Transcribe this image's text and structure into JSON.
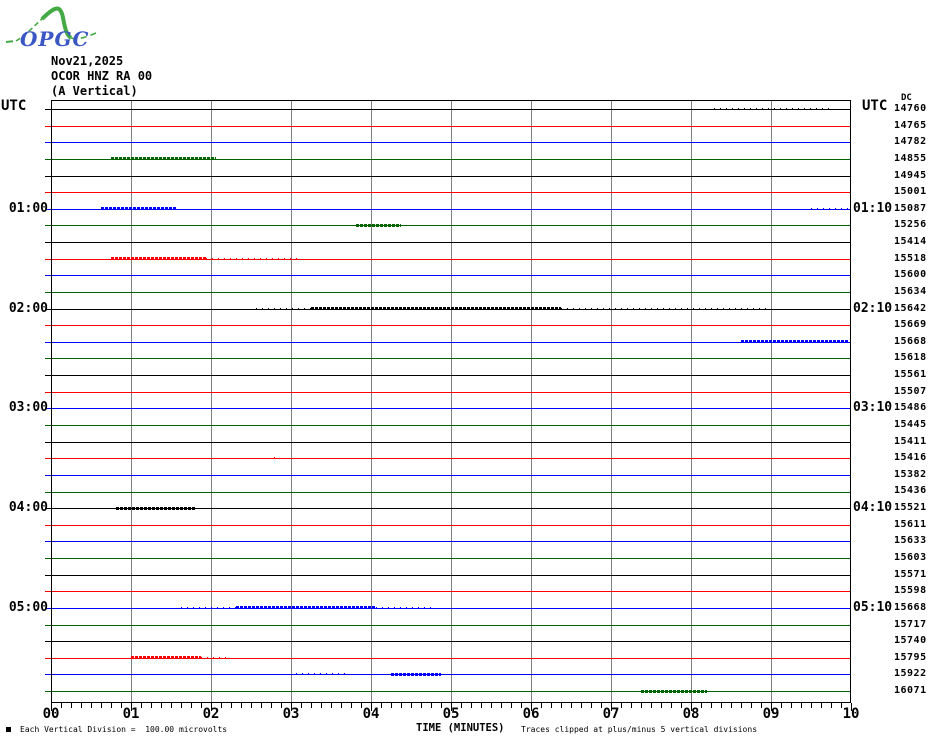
{
  "header": {
    "logo_text": "OPGC",
    "date": "Nov21,2025",
    "station": "OCOR HNZ RA 00",
    "component": "(A Vertical)"
  },
  "axes": {
    "left_utc": "UTC",
    "right_utc": "UTC",
    "dc_label": "DC",
    "x_title": "TIME (MINUTES)",
    "x_tick_labels": [
      "00",
      "01",
      "02",
      "03",
      "04",
      "05",
      "06",
      "07",
      "08",
      "09",
      "10"
    ]
  },
  "footer": {
    "scale_note": "Each Vertical Division =  100.00 microvolts",
    "clip_note": "Traces clipped at plus/minus 5 vertical divisions"
  },
  "colors": {
    "black": "#000000",
    "red": "#ff0000",
    "blue": "#0000ff",
    "green": "#006400",
    "grid": "#808080",
    "logo_green": "#44aa44",
    "logo_blue": "#3a57c4"
  },
  "chart_data": {
    "type": "line",
    "description": "Helicorder-style seismogram: 36 ten-minute traces stacked vertically, trace color cycles black/red/blue/green, DC offset of each trace listed at right, noise bursts shown as fuzzy segments",
    "x_axis": {
      "title": "TIME (MINUTES)",
      "min": 0,
      "max": 10,
      "major_tick_step": 1,
      "minor_ticks_per_division": 8
    },
    "y_axis": {
      "division_microvolts": 100.0,
      "clip_divisions": 5
    },
    "utc_left_labels": [
      "01:00",
      "02:00",
      "03:00",
      "04:00",
      "05:00"
    ],
    "utc_right_labels": [
      "01:10",
      "02:10",
      "03:10",
      "04:10",
      "05:10"
    ],
    "traces": [
      {
        "color": "black",
        "dc": 14760,
        "left_label": "",
        "right_label": "",
        "noise": [
          [
            8.28,
            9.74,
            "sparse"
          ]
        ]
      },
      {
        "color": "red",
        "dc": 14765,
        "left_label": "",
        "right_label": "",
        "noise": []
      },
      {
        "color": "blue",
        "dc": 14782,
        "left_label": "",
        "right_label": "",
        "noise": []
      },
      {
        "color": "green",
        "dc": 14855,
        "left_label": "",
        "right_label": "",
        "noise": [
          [
            0.74,
            2.05,
            "dense"
          ]
        ]
      },
      {
        "color": "black",
        "dc": 14945,
        "left_label": "",
        "right_label": "",
        "noise": []
      },
      {
        "color": "red",
        "dc": 15001,
        "left_label": "",
        "right_label": "",
        "noise": []
      },
      {
        "color": "blue",
        "dc": 15087,
        "left_label": "01:00",
        "right_label": "01:10",
        "noise": [
          [
            0.61,
            1.55,
            "dense"
          ],
          [
            9.49,
            9.99,
            "sparse"
          ]
        ]
      },
      {
        "color": "green",
        "dc": 15256,
        "left_label": "",
        "right_label": "",
        "noise": [
          [
            3.8,
            4.36,
            "dense"
          ]
        ]
      },
      {
        "color": "black",
        "dc": 15414,
        "left_label": "",
        "right_label": "",
        "noise": []
      },
      {
        "color": "red",
        "dc": 15518,
        "left_label": "",
        "right_label": "",
        "noise": [
          [
            0.74,
            1.93,
            "dense"
          ],
          [
            1.93,
            3.11,
            "sparse"
          ]
        ]
      },
      {
        "color": "blue",
        "dc": 15600,
        "left_label": "",
        "right_label": "",
        "noise": []
      },
      {
        "color": "green",
        "dc": 15634,
        "left_label": "",
        "right_label": "",
        "noise": []
      },
      {
        "color": "black",
        "dc": 15642,
        "left_label": "02:00",
        "right_label": "02:10",
        "noise": [
          [
            2.55,
            3.24,
            "sparse"
          ],
          [
            3.24,
            6.36,
            "dense"
          ],
          [
            6.36,
            8.99,
            "sparse"
          ]
        ]
      },
      {
        "color": "red",
        "dc": 15669,
        "left_label": "",
        "right_label": "",
        "noise": []
      },
      {
        "color": "blue",
        "dc": 15668,
        "left_label": "",
        "right_label": "",
        "noise": [
          [
            8.61,
            9.96,
            "dense"
          ]
        ]
      },
      {
        "color": "green",
        "dc": 15618,
        "left_label": "",
        "right_label": "",
        "noise": []
      },
      {
        "color": "black",
        "dc": 15561,
        "left_label": "",
        "right_label": "",
        "noise": []
      },
      {
        "color": "red",
        "dc": 15507,
        "left_label": "",
        "right_label": "",
        "noise": []
      },
      {
        "color": "blue",
        "dc": 15486,
        "left_label": "03:00",
        "right_label": "03:10",
        "noise": []
      },
      {
        "color": "green",
        "dc": 15445,
        "left_label": "",
        "right_label": "",
        "noise": []
      },
      {
        "color": "black",
        "dc": 15411,
        "left_label": "",
        "right_label": "",
        "noise": []
      },
      {
        "color": "red",
        "dc": 15416,
        "left_label": "",
        "right_label": "",
        "noise": [
          [
            2.78,
            2.83,
            "sparse"
          ]
        ]
      },
      {
        "color": "blue",
        "dc": 15382,
        "left_label": "",
        "right_label": "",
        "noise": []
      },
      {
        "color": "green",
        "dc": 15436,
        "left_label": "",
        "right_label": "",
        "noise": []
      },
      {
        "color": "black",
        "dc": 15521,
        "left_label": "04:00",
        "right_label": "04:10",
        "noise": [
          [
            0.8,
            1.8,
            "dense"
          ]
        ]
      },
      {
        "color": "red",
        "dc": 15611,
        "left_label": "",
        "right_label": "",
        "noise": []
      },
      {
        "color": "blue",
        "dc": 15633,
        "left_label": "",
        "right_label": "",
        "noise": []
      },
      {
        "color": "green",
        "dc": 15603,
        "left_label": "",
        "right_label": "",
        "noise": []
      },
      {
        "color": "black",
        "dc": 15571,
        "left_label": "",
        "right_label": "",
        "noise": []
      },
      {
        "color": "red",
        "dc": 15598,
        "left_label": "",
        "right_label": "",
        "noise": []
      },
      {
        "color": "blue",
        "dc": 15668,
        "left_label": "05:00",
        "right_label": "05:10",
        "noise": [
          [
            1.61,
            2.3,
            "sparse"
          ],
          [
            2.3,
            4.05,
            "dense"
          ],
          [
            4.05,
            4.74,
            "sparse"
          ]
        ]
      },
      {
        "color": "green",
        "dc": 15717,
        "left_label": "",
        "right_label": "",
        "noise": []
      },
      {
        "color": "black",
        "dc": 15740,
        "left_label": "",
        "right_label": "",
        "noise": []
      },
      {
        "color": "red",
        "dc": 15795,
        "left_label": "",
        "right_label": "",
        "noise": [
          [
            0.99,
            1.86,
            "dense"
          ],
          [
            1.86,
            2.24,
            "sparse"
          ]
        ]
      },
      {
        "color": "blue",
        "dc": 15922,
        "left_label": "",
        "right_label": "",
        "noise": [
          [
            3.05,
            3.68,
            "sparse"
          ],
          [
            4.24,
            4.86,
            "dense"
          ]
        ]
      },
      {
        "color": "green",
        "dc": 16071,
        "left_label": "",
        "right_label": "",
        "noise": [
          [
            7.36,
            8.18,
            "dense"
          ]
        ]
      }
    ]
  }
}
